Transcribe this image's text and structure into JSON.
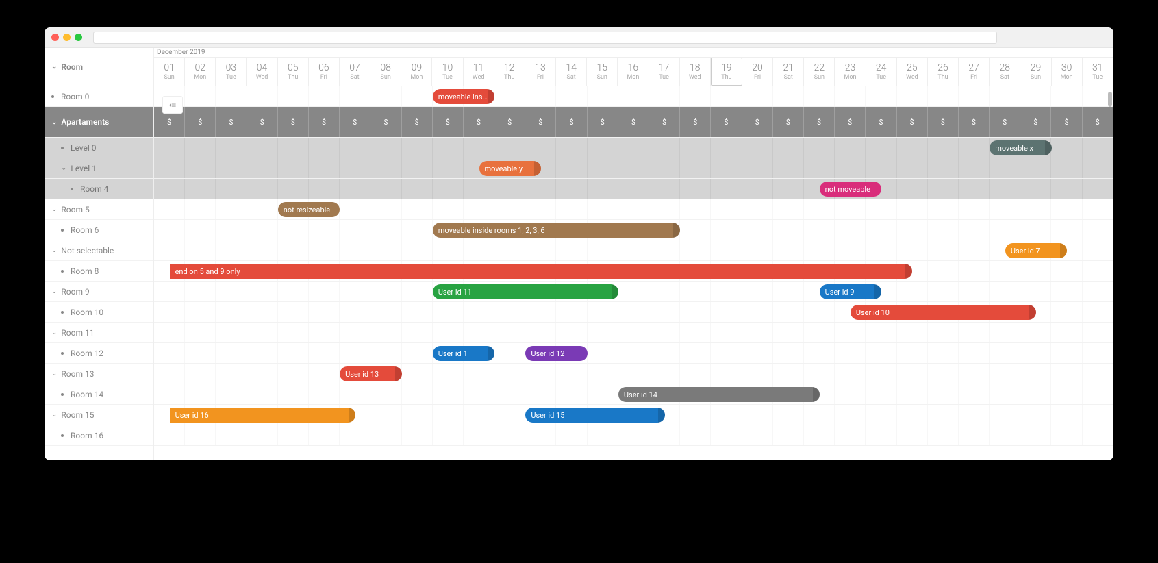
{
  "window": {
    "url": ""
  },
  "month_label": "December 2019",
  "sidebar_title": "Room",
  "days": [
    {
      "num": "01",
      "wd": "Sun"
    },
    {
      "num": "02",
      "wd": "Mon"
    },
    {
      "num": "03",
      "wd": "Tue"
    },
    {
      "num": "04",
      "wd": "Wed"
    },
    {
      "num": "05",
      "wd": "Thu"
    },
    {
      "num": "06",
      "wd": "Fri"
    },
    {
      "num": "07",
      "wd": "Sat"
    },
    {
      "num": "08",
      "wd": "Sun"
    },
    {
      "num": "09",
      "wd": "Mon"
    },
    {
      "num": "10",
      "wd": "Tue"
    },
    {
      "num": "11",
      "wd": "Wed"
    },
    {
      "num": "12",
      "wd": "Thu"
    },
    {
      "num": "13",
      "wd": "Fri"
    },
    {
      "num": "14",
      "wd": "Sat"
    },
    {
      "num": "15",
      "wd": "Sun"
    },
    {
      "num": "16",
      "wd": "Mon"
    },
    {
      "num": "17",
      "wd": "Tue"
    },
    {
      "num": "18",
      "wd": "Wed"
    },
    {
      "num": "19",
      "wd": "Thu",
      "today": true
    },
    {
      "num": "20",
      "wd": "Fri"
    },
    {
      "num": "21",
      "wd": "Sat"
    },
    {
      "num": "22",
      "wd": "Sun"
    },
    {
      "num": "23",
      "wd": "Mon"
    },
    {
      "num": "24",
      "wd": "Tue"
    },
    {
      "num": "25",
      "wd": "Wed"
    },
    {
      "num": "26",
      "wd": "Thu"
    },
    {
      "num": "27",
      "wd": "Fri"
    },
    {
      "num": "28",
      "wd": "Sat"
    },
    {
      "num": "29",
      "wd": "Sun"
    },
    {
      "num": "30",
      "wd": "Mon"
    },
    {
      "num": "31",
      "wd": "Tue"
    }
  ],
  "dollar": "$",
  "rows": [
    {
      "id": "room0",
      "label": "Room 0",
      "type": "room",
      "bullet": true,
      "indent": 0
    },
    {
      "id": "aparts",
      "label": "Apartaments",
      "type": "apart",
      "chev": true,
      "indent": 0
    },
    {
      "id": "level0",
      "label": "Level 0",
      "type": "level",
      "bullet": true,
      "indent": 1
    },
    {
      "id": "level1",
      "label": "Level 1",
      "type": "level",
      "chev": true,
      "indent": 1
    },
    {
      "id": "room4",
      "label": "Room 4",
      "type": "level2",
      "bullet": true,
      "indent": 2
    },
    {
      "id": "room5",
      "label": "Room 5",
      "type": "room",
      "chev": true,
      "indent": 0
    },
    {
      "id": "room6",
      "label": "Room 6",
      "type": "room",
      "bullet": true,
      "indent": 1
    },
    {
      "id": "notsel",
      "label": "Not selectable",
      "type": "room",
      "chev": true,
      "indent": 0
    },
    {
      "id": "room8",
      "label": "Room 8",
      "type": "room",
      "bullet": true,
      "indent": 1
    },
    {
      "id": "room9",
      "label": "Room 9",
      "type": "room",
      "chev": true,
      "indent": 0
    },
    {
      "id": "room10",
      "label": "Room 10",
      "type": "room",
      "bullet": true,
      "indent": 1
    },
    {
      "id": "room11",
      "label": "Room 11",
      "type": "room",
      "chev": true,
      "indent": 0
    },
    {
      "id": "room12",
      "label": "Room 12",
      "type": "room",
      "bullet": true,
      "indent": 1
    },
    {
      "id": "room13",
      "label": "Room 13",
      "type": "room",
      "chev": true,
      "indent": 0
    },
    {
      "id": "room14",
      "label": "Room 14",
      "type": "room",
      "bullet": true,
      "indent": 1
    },
    {
      "id": "room15",
      "label": "Room 15",
      "type": "room",
      "chev": true,
      "indent": 0
    },
    {
      "id": "room16",
      "label": "Room 16",
      "type": "room",
      "bullet": true,
      "indent": 1
    }
  ],
  "events": [
    {
      "row": "room0",
      "label": "moveable ins…",
      "start": 9,
      "dur": 2,
      "color": "#e44b3b",
      "handle": true
    },
    {
      "row": "level0",
      "label": "moveable x",
      "start": 27,
      "dur": 2,
      "color": "#5c7371",
      "handle": true
    },
    {
      "row": "level1",
      "label": "moveable y",
      "start": 10.5,
      "dur": 2,
      "color": "#e8713d",
      "handle": true
    },
    {
      "row": "room4",
      "label": "not moveable",
      "start": 21.5,
      "dur": 2,
      "color": "#d92d7b",
      "handle": false
    },
    {
      "row": "room5",
      "label": "not resizeable",
      "start": 4,
      "dur": 2,
      "color": "#a1794f",
      "handle": false
    },
    {
      "row": "room6",
      "label": "moveable inside rooms 1, 2, 3, 6",
      "start": 9,
      "dur": 8,
      "color": "#a1794f",
      "handle": true
    },
    {
      "row": "notsel",
      "label": "User id 7",
      "start": 27.5,
      "dur": 2,
      "color": "#f2941f",
      "handle": true
    },
    {
      "row": "room8",
      "label": "end on 5 and 9 only",
      "start": 0.5,
      "dur": 24,
      "color": "#e44b3b",
      "handle": true,
      "flatLeft": true
    },
    {
      "row": "room9",
      "label": "User id 11",
      "start": 9,
      "dur": 6,
      "color": "#28a342",
      "handle": true
    },
    {
      "row": "room9",
      "label": "User id 9",
      "start": 21.5,
      "dur": 2,
      "color": "#1978c7",
      "handle": true
    },
    {
      "row": "room10",
      "label": "User id 10",
      "start": 22.5,
      "dur": 6,
      "color": "#e44b3b",
      "handle": true
    },
    {
      "row": "room12",
      "label": "User id 1",
      "start": 9,
      "dur": 2,
      "color": "#1978c7",
      "handle": true
    },
    {
      "row": "room12",
      "label": "User id 12",
      "start": 12,
      "dur": 2,
      "color": "#7a3ab5",
      "handle": false
    },
    {
      "row": "room13",
      "label": "User id 13",
      "start": 6,
      "dur": 2,
      "color": "#e44b3b",
      "handle": true
    },
    {
      "row": "room14",
      "label": "User id 14",
      "start": 15,
      "dur": 6.5,
      "color": "#7a7a7a",
      "handle": true
    },
    {
      "row": "room15",
      "label": "User id 16",
      "start": 0.5,
      "dur": 6,
      "color": "#f2941f",
      "handle": true,
      "flatLeft": true
    },
    {
      "row": "room15",
      "label": "User id 15",
      "start": 12,
      "dur": 4.5,
      "color": "#1978c7",
      "handle": true
    }
  ],
  "toggle_icon": "‹≡"
}
